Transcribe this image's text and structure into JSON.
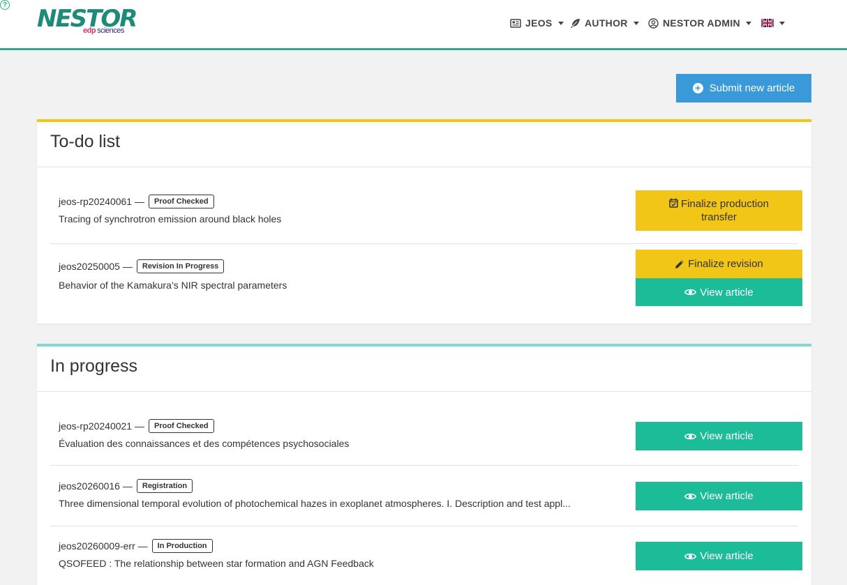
{
  "navbar": {
    "logo_text": "NESTOR",
    "logo_sub_brand": "edp",
    "logo_sub_text": "sciences",
    "menu": {
      "jeos": "JEOS",
      "author": "AUTHOR",
      "admin": "NESTOR ADMIN"
    },
    "help_glyph": "?",
    "colors": {
      "accent_border": "#2ba98e"
    }
  },
  "actions": {
    "submit_label": "Submit new article"
  },
  "todo": {
    "title": "To-do list",
    "items": [
      {
        "id": "jeos-rp20240061",
        "separator": "—",
        "status": "Proof Checked",
        "title": "Tracing of synchrotron emission around black holes",
        "buttons": [
          "Finalize production transfer"
        ]
      },
      {
        "id": "jeos20250005",
        "separator": "—",
        "status": "Revision In Progress",
        "title": "Behavior of the Kamakura’s NIR spectral parameters",
        "buttons": [
          "Finalize revision",
          "View article"
        ]
      }
    ]
  },
  "in_progress": {
    "title": "In progress",
    "items": [
      {
        "id": "jeos-rp20240021",
        "separator": "—",
        "status": "Proof Checked",
        "title": "Évaluation des connaissances et des compétences psychosociales",
        "button": "View article"
      },
      {
        "id": "jeos20260016",
        "separator": "—",
        "status": "Registration",
        "title": "Three dimensional temporal evolution of photochemical hazes in exoplanet atmospheres. I. Description and test appl...",
        "button": "View article"
      },
      {
        "id": "jeos20260009-err",
        "separator": "—",
        "status": "In Production",
        "title": "QSOFEED : The relationship between star formation and AGN Feedback",
        "button": "View article"
      }
    ]
  },
  "icons": {
    "jeos": "newspaper-icon",
    "author": "feather-icon",
    "admin": "user-circle-icon",
    "language": "uk-flag-icon",
    "help": "question-circle-icon",
    "submit": "plus-circle-icon",
    "finalize_transfer": "calendar-check-icon",
    "finalize_revision": "pencil-icon",
    "view": "eye-icon"
  },
  "colors": {
    "todo_accent": "#f2c617",
    "progress_accent": "#7fd9cf",
    "primary_button": "#3a9ad9",
    "view_button": "#1cbc99",
    "action_button": "#f2c617"
  }
}
